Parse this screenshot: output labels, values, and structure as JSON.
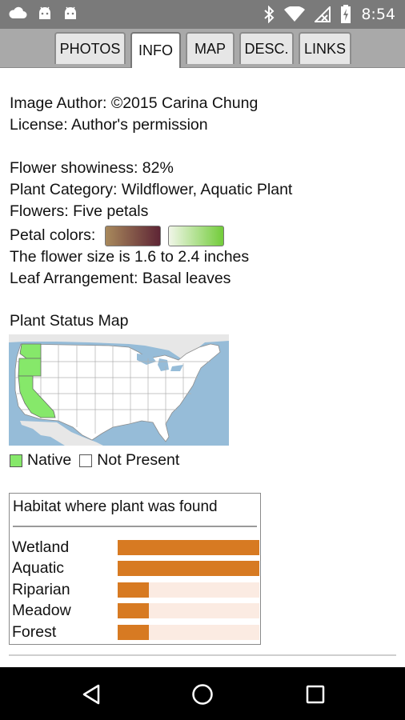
{
  "status_bar": {
    "time": "8:54",
    "left_icons": [
      "cloud-icon",
      "android-icon",
      "android-icon"
    ],
    "right_icons": [
      "bluetooth-icon",
      "wifi-icon",
      "no-signal-icon",
      "battery-icon"
    ]
  },
  "tabs": [
    {
      "label": "PHOTOS",
      "active": false
    },
    {
      "label": "INFO",
      "active": true
    },
    {
      "label": "MAP",
      "active": false
    },
    {
      "label": "DESC.",
      "active": false
    },
    {
      "label": "LINKS",
      "active": false
    }
  ],
  "info": {
    "image_author": "Image Author: ©2015 Carina Chung",
    "license": "License: Author's permission",
    "showiness": "Flower showiness: 82%",
    "category": "Plant Category: Wildflower, Aquatic Plant",
    "flowers": "Flowers: Five petals",
    "petal_colors_label": "Petal colors:",
    "size": "The flower size is 1.6 to 2.4 inches",
    "leaf": "Leaf Arrangement: Basal leaves"
  },
  "petal_swatches": [
    {
      "from": "#a8895c",
      "to": "#5e2535"
    },
    {
      "from": "#f1f6e8",
      "to": "#72cc3a"
    }
  ],
  "status_map": {
    "title": "Plant Status Map",
    "native_color": "#86e86a",
    "legend": [
      {
        "label": "Native",
        "color": "#86e86a"
      },
      {
        "label": "Not Present",
        "color": "#ffffff"
      }
    ]
  },
  "habitat": {
    "title": "Habitat where plant was found",
    "bar_color": "#d77a22",
    "track_color": "#fbebe2",
    "rows": [
      {
        "label": "Wetland",
        "value": 1.0
      },
      {
        "label": "Aquatic",
        "value": 1.0
      },
      {
        "label": "Riparian",
        "value": 0.22
      },
      {
        "label": "Meadow",
        "value": 0.22
      },
      {
        "label": "Forest",
        "value": 0.22
      }
    ]
  },
  "nav_bar": {
    "buttons": [
      "back-icon",
      "home-icon",
      "recents-icon"
    ]
  }
}
